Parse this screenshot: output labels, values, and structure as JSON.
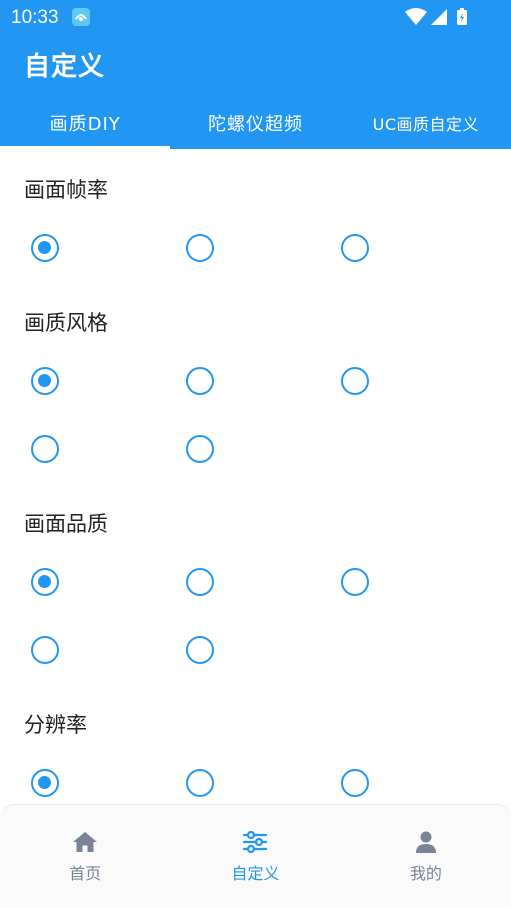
{
  "status": {
    "time": "10:33"
  },
  "app": {
    "title": "自定义"
  },
  "tabs": [
    {
      "label": "画质DIY",
      "active": true
    },
    {
      "label": "陀螺仪超频",
      "active": false
    },
    {
      "label": "UC画质自定义",
      "active": false
    }
  ],
  "sections": [
    {
      "title": "画面帧率",
      "options": [
        {
          "checked": true
        },
        {
          "checked": false
        },
        {
          "checked": false
        }
      ]
    },
    {
      "title": "画质风格",
      "options": [
        {
          "checked": true
        },
        {
          "checked": false
        },
        {
          "checked": false
        },
        {
          "checked": false
        },
        {
          "checked": false
        }
      ]
    },
    {
      "title": "画面品质",
      "options": [
        {
          "checked": true
        },
        {
          "checked": false
        },
        {
          "checked": false
        },
        {
          "checked": false
        },
        {
          "checked": false
        }
      ]
    },
    {
      "title": "分辨率",
      "options": [
        {
          "checked": true
        },
        {
          "checked": false
        },
        {
          "checked": false
        }
      ]
    }
  ],
  "bottom_nav": [
    {
      "label": "首页",
      "icon": "home-icon",
      "active": false
    },
    {
      "label": "自定义",
      "icon": "sliders-icon",
      "active": true
    },
    {
      "label": "我的",
      "icon": "person-icon",
      "active": false
    }
  ],
  "colors": {
    "primary": "#2196F3",
    "nav_inactive": "#7a8496"
  }
}
